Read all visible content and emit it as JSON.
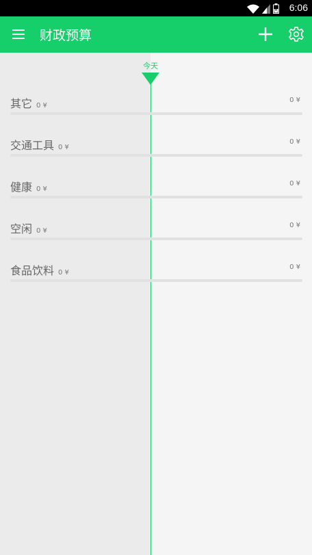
{
  "status_bar": {
    "time": "6:06",
    "icons": [
      "wifi-icon",
      "signal-icon",
      "battery-icon"
    ]
  },
  "app_bar": {
    "title": "财政预算",
    "menu_icon": "menu-icon",
    "add_icon": "plus-icon",
    "settings_icon": "gear-icon",
    "color": "#17cf6a"
  },
  "timeline": {
    "today_label": "今天"
  },
  "categories": [
    {
      "name": "其它",
      "amount": "0 ¥",
      "right_amount": "0 ¥"
    },
    {
      "name": "交通工具",
      "amount": "0 ¥",
      "right_amount": "0 ¥"
    },
    {
      "name": "健康",
      "amount": "0 ¥",
      "right_amount": "0 ¥"
    },
    {
      "name": "空闲",
      "amount": "0 ¥",
      "right_amount": "0 ¥"
    },
    {
      "name": "食品饮料",
      "amount": "0 ¥",
      "right_amount": "0 ¥"
    }
  ]
}
